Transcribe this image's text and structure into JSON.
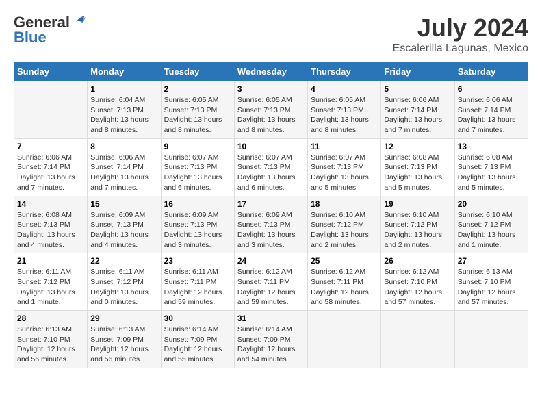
{
  "header": {
    "logo_line1": "General",
    "logo_line2": "Blue",
    "main_title": "July 2024",
    "subtitle": "Escalerilla Lagunas, Mexico"
  },
  "days_of_week": [
    "Sunday",
    "Monday",
    "Tuesday",
    "Wednesday",
    "Thursday",
    "Friday",
    "Saturday"
  ],
  "weeks": [
    [
      {
        "day": "",
        "info": ""
      },
      {
        "day": "1",
        "info": "Sunrise: 6:04 AM\nSunset: 7:13 PM\nDaylight: 13 hours\nand 8 minutes."
      },
      {
        "day": "2",
        "info": "Sunrise: 6:05 AM\nSunset: 7:13 PM\nDaylight: 13 hours\nand 8 minutes."
      },
      {
        "day": "3",
        "info": "Sunrise: 6:05 AM\nSunset: 7:13 PM\nDaylight: 13 hours\nand 8 minutes."
      },
      {
        "day": "4",
        "info": "Sunrise: 6:05 AM\nSunset: 7:13 PM\nDaylight: 13 hours\nand 8 minutes."
      },
      {
        "day": "5",
        "info": "Sunrise: 6:06 AM\nSunset: 7:14 PM\nDaylight: 13 hours\nand 7 minutes."
      },
      {
        "day": "6",
        "info": "Sunrise: 6:06 AM\nSunset: 7:14 PM\nDaylight: 13 hours\nand 7 minutes."
      }
    ],
    [
      {
        "day": "7",
        "info": "Sunrise: 6:06 AM\nSunset: 7:14 PM\nDaylight: 13 hours\nand 7 minutes."
      },
      {
        "day": "8",
        "info": "Sunrise: 6:06 AM\nSunset: 7:14 PM\nDaylight: 13 hours\nand 7 minutes."
      },
      {
        "day": "9",
        "info": "Sunrise: 6:07 AM\nSunset: 7:13 PM\nDaylight: 13 hours\nand 6 minutes."
      },
      {
        "day": "10",
        "info": "Sunrise: 6:07 AM\nSunset: 7:13 PM\nDaylight: 13 hours\nand 6 minutes."
      },
      {
        "day": "11",
        "info": "Sunrise: 6:07 AM\nSunset: 7:13 PM\nDaylight: 13 hours\nand 5 minutes."
      },
      {
        "day": "12",
        "info": "Sunrise: 6:08 AM\nSunset: 7:13 PM\nDaylight: 13 hours\nand 5 minutes."
      },
      {
        "day": "13",
        "info": "Sunrise: 6:08 AM\nSunset: 7:13 PM\nDaylight: 13 hours\nand 5 minutes."
      }
    ],
    [
      {
        "day": "14",
        "info": "Sunrise: 6:08 AM\nSunset: 7:13 PM\nDaylight: 13 hours\nand 4 minutes."
      },
      {
        "day": "15",
        "info": "Sunrise: 6:09 AM\nSunset: 7:13 PM\nDaylight: 13 hours\nand 4 minutes."
      },
      {
        "day": "16",
        "info": "Sunrise: 6:09 AM\nSunset: 7:13 PM\nDaylight: 13 hours\nand 3 minutes."
      },
      {
        "day": "17",
        "info": "Sunrise: 6:09 AM\nSunset: 7:13 PM\nDaylight: 13 hours\nand 3 minutes."
      },
      {
        "day": "18",
        "info": "Sunrise: 6:10 AM\nSunset: 7:12 PM\nDaylight: 13 hours\nand 2 minutes."
      },
      {
        "day": "19",
        "info": "Sunrise: 6:10 AM\nSunset: 7:12 PM\nDaylight: 13 hours\nand 2 minutes."
      },
      {
        "day": "20",
        "info": "Sunrise: 6:10 AM\nSunset: 7:12 PM\nDaylight: 13 hours\nand 1 minute."
      }
    ],
    [
      {
        "day": "21",
        "info": "Sunrise: 6:11 AM\nSunset: 7:12 PM\nDaylight: 13 hours\nand 1 minute."
      },
      {
        "day": "22",
        "info": "Sunrise: 6:11 AM\nSunset: 7:12 PM\nDaylight: 13 hours\nand 0 minutes."
      },
      {
        "day": "23",
        "info": "Sunrise: 6:11 AM\nSunset: 7:11 PM\nDaylight: 12 hours\nand 59 minutes."
      },
      {
        "day": "24",
        "info": "Sunrise: 6:12 AM\nSunset: 7:11 PM\nDaylight: 12 hours\nand 59 minutes."
      },
      {
        "day": "25",
        "info": "Sunrise: 6:12 AM\nSunset: 7:11 PM\nDaylight: 12 hours\nand 58 minutes."
      },
      {
        "day": "26",
        "info": "Sunrise: 6:12 AM\nSunset: 7:10 PM\nDaylight: 12 hours\nand 57 minutes."
      },
      {
        "day": "27",
        "info": "Sunrise: 6:13 AM\nSunset: 7:10 PM\nDaylight: 12 hours\nand 57 minutes."
      }
    ],
    [
      {
        "day": "28",
        "info": "Sunrise: 6:13 AM\nSunset: 7:10 PM\nDaylight: 12 hours\nand 56 minutes."
      },
      {
        "day": "29",
        "info": "Sunrise: 6:13 AM\nSunset: 7:09 PM\nDaylight: 12 hours\nand 56 minutes."
      },
      {
        "day": "30",
        "info": "Sunrise: 6:14 AM\nSunset: 7:09 PM\nDaylight: 12 hours\nand 55 minutes."
      },
      {
        "day": "31",
        "info": "Sunrise: 6:14 AM\nSunset: 7:09 PM\nDaylight: 12 hours\nand 54 minutes."
      },
      {
        "day": "",
        "info": ""
      },
      {
        "day": "",
        "info": ""
      },
      {
        "day": "",
        "info": ""
      }
    ]
  ]
}
